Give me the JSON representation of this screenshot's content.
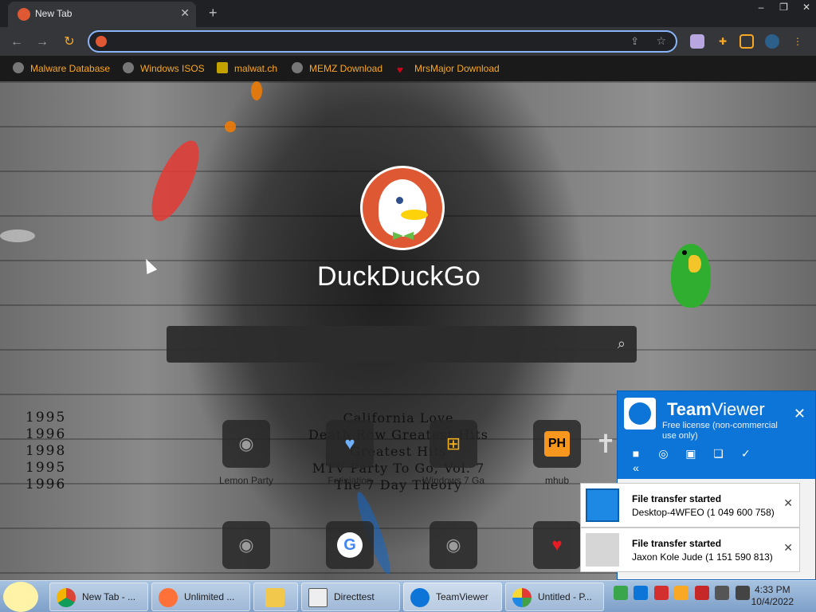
{
  "browser": {
    "tab_title": "New Tab",
    "tab_close": "✕",
    "new_tab": "+",
    "window_controls": [
      "–",
      "❐",
      "✕"
    ],
    "address_value": "",
    "bookmarks": [
      {
        "label": "Malware Database",
        "icon": "globe-icon"
      },
      {
        "label": "Windows ISOS",
        "icon": "globe-icon"
      },
      {
        "label": "malwat.ch",
        "icon": "malwatch-icon"
      },
      {
        "label": "MEMZ Download",
        "icon": "globe-icon"
      },
      {
        "label": "MrsMajor Download",
        "icon": "heart-icon"
      }
    ]
  },
  "page": {
    "logo_word": "DuckDuckGo",
    "search_value": "",
    "years": [
      "1995",
      "1996",
      "1998",
      "1995",
      "1996"
    ],
    "albums": [
      "California Love",
      "Death Row Greatest Hits",
      "Greatest Hits",
      "MTV Party To Go, Vol. 7",
      "The 7 Day Theory"
    ],
    "tiles_row1": [
      {
        "label": "Lemon Party",
        "icon": "globe-icon"
      },
      {
        "label": "Fetiniation",
        "icon": "heart-icon"
      },
      {
        "label": "Windows 7 Ga",
        "icon": "windows-icon"
      },
      {
        "label": "mhub",
        "icon": "ph-icon",
        "text": "PH"
      },
      {
        "label": "",
        "icon": "cross-icon"
      }
    ],
    "tiles_row2": [
      {
        "label": "",
        "icon": "globe-icon"
      },
      {
        "label": "",
        "icon": "google-icon",
        "text": "G"
      },
      {
        "label": "",
        "icon": "globe-icon"
      },
      {
        "label": "",
        "icon": "heart-icon"
      }
    ]
  },
  "teamviewer": {
    "brand_team": "Team",
    "brand_viewer": "Viewer",
    "license": "Free license (non-commercial use only)",
    "close": "✕",
    "notifications": [
      {
        "title": "File transfer started",
        "detail": "Desktop-4WFEO (1 049 600 758)"
      },
      {
        "title": "File transfer started",
        "detail": "Jaxon Kole Jude (1 151 590 813)"
      }
    ]
  },
  "taskbar": {
    "items": [
      {
        "label": "New Tab - ...",
        "icon": "chrome-icon"
      },
      {
        "label": "Unlimited ...",
        "icon": "firefox-icon"
      },
      {
        "label": "",
        "icon": "folder-icon"
      },
      {
        "label": "Directtest",
        "icon": "app-icon"
      },
      {
        "label": "TeamViewer",
        "icon": "teamviewer-icon"
      },
      {
        "label": "Untitled - P...",
        "icon": "paint-icon"
      }
    ],
    "time": "4:33 PM",
    "date": "10/4/2022"
  }
}
